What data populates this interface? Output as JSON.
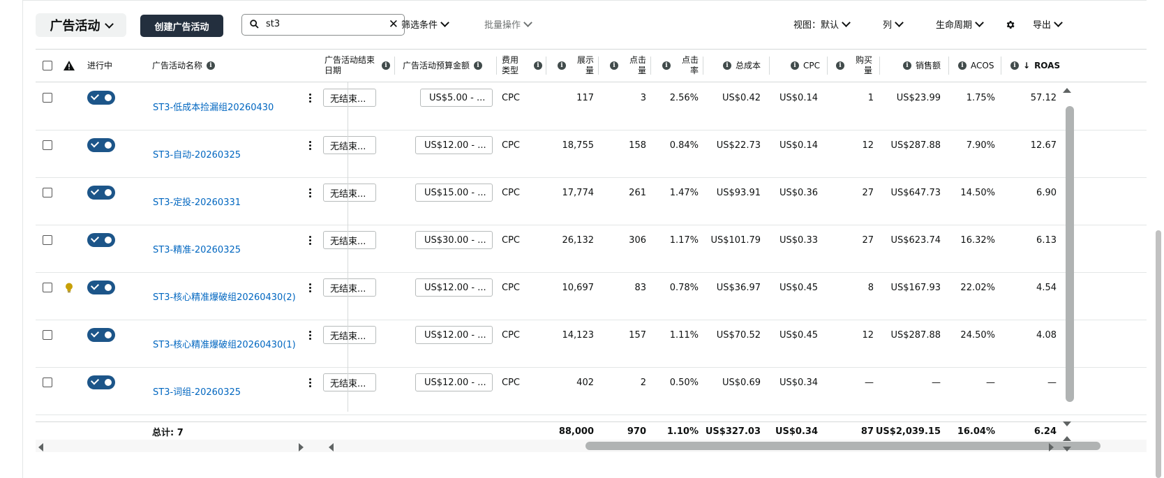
{
  "toolbar": {
    "campaign_dropdown": "广告活动",
    "create_button": "创建广告活动",
    "search_value": "st3",
    "filter": "筛选条件",
    "bulk": "批量操作",
    "view": "视图：默认",
    "columns": "列",
    "lifecycle": "生命周期",
    "export": "导出"
  },
  "headers": {
    "active": "进行中",
    "name": "广告活动名称",
    "end_date": "广告活动结束日期",
    "budget": "广告活动预算金额",
    "cost_type": "费用类型",
    "impressions": "展示量",
    "clicks": "点击量",
    "ctr": "点击率",
    "spend": "总成本",
    "cpc": "CPC",
    "orders": "购买量",
    "sales": "销售额",
    "acos": "ACOS",
    "roas": "ROAS",
    "sort_arrow": "↓"
  },
  "rows": [
    {
      "name": "ST3-低成本捡漏组20260430",
      "end": "无结束...",
      "budget": "US$5.00 - ...",
      "type": "CPC",
      "impr": "117",
      "clicks": "3",
      "ctr": "2.56%",
      "spend": "US$0.42",
      "cpc": "US$0.14",
      "orders": "1",
      "sales": "US$23.99",
      "acos": "1.75%",
      "roas": "57.12",
      "bulb": false
    },
    {
      "name": "ST3-自动-20260325",
      "end": "无结束...",
      "budget": "US$12.00 - ...",
      "type": "CPC",
      "impr": "18,755",
      "clicks": "158",
      "ctr": "0.84%",
      "spend": "US$22.73",
      "cpc": "US$0.14",
      "orders": "12",
      "sales": "US$287.88",
      "acos": "7.90%",
      "roas": "12.67",
      "bulb": false
    },
    {
      "name": "ST3-定投-20260331",
      "end": "无结束...",
      "budget": "US$15.00 - ...",
      "type": "CPC",
      "impr": "17,774",
      "clicks": "261",
      "ctr": "1.47%",
      "spend": "US$93.91",
      "cpc": "US$0.36",
      "orders": "27",
      "sales": "US$647.73",
      "acos": "14.50%",
      "roas": "6.90",
      "bulb": false
    },
    {
      "name": "ST3-精准-20260325",
      "end": "无结束...",
      "budget": "US$30.00 - ...",
      "type": "CPC",
      "impr": "26,132",
      "clicks": "306",
      "ctr": "1.17%",
      "spend": "US$101.79",
      "cpc": "US$0.33",
      "orders": "27",
      "sales": "US$623.74",
      "acos": "16.32%",
      "roas": "6.13",
      "bulb": false
    },
    {
      "name": "ST3-核心精准爆破组20260430(2)",
      "end": "无结束...",
      "budget": "US$12.00 - ...",
      "type": "CPC",
      "impr": "10,697",
      "clicks": "83",
      "ctr": "0.78%",
      "spend": "US$36.97",
      "cpc": "US$0.45",
      "orders": "8",
      "sales": "US$167.93",
      "acos": "22.02%",
      "roas": "4.54",
      "bulb": true
    },
    {
      "name": "ST3-核心精准爆破组20260430(1)",
      "end": "无结束...",
      "budget": "US$12.00 - ...",
      "type": "CPC",
      "impr": "14,123",
      "clicks": "157",
      "ctr": "1.11%",
      "spend": "US$70.52",
      "cpc": "US$0.45",
      "orders": "12",
      "sales": "US$287.88",
      "acos": "24.50%",
      "roas": "4.08",
      "bulb": false
    },
    {
      "name": "ST3-词组-20260325",
      "end": "无结束...",
      "budget": "US$12.00 - ...",
      "type": "CPC",
      "impr": "402",
      "clicks": "2",
      "ctr": "0.50%",
      "spend": "US$0.69",
      "cpc": "US$0.34",
      "orders": "—",
      "sales": "—",
      "acos": "—",
      "roas": "—",
      "bulb": false
    }
  ],
  "totals": {
    "label": "总计: 7",
    "impr": "88,000",
    "clicks": "970",
    "ctr": "1.10%",
    "spend": "US$327.03",
    "cpc": "US$0.34",
    "orders": "87",
    "sales": "US$2,039.15",
    "acos": "16.04%",
    "roas": "6.24"
  },
  "colors": {
    "link": "#0066c0",
    "toggle": "#1c5589",
    "button_dark": "#232f3e",
    "bulb": "#c7a008"
  }
}
